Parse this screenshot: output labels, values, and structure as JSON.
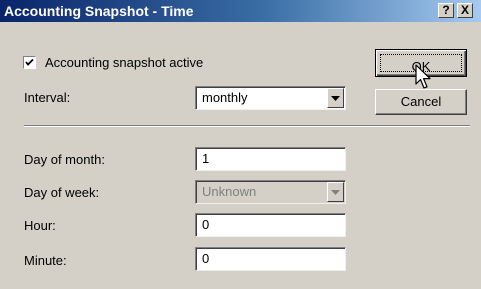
{
  "window": {
    "title": "Accounting Snapshot - Time",
    "help_label": "?",
    "close_label": "X"
  },
  "snapshot": {
    "label": "Accounting snapshot active",
    "checked": true
  },
  "interval": {
    "label": "Interval:",
    "value": "monthly"
  },
  "day_of_month": {
    "label": "Day of month:",
    "value": "1"
  },
  "day_of_week": {
    "label": "Day of week:",
    "value": "Unknown",
    "disabled": true
  },
  "hour": {
    "label": "Hour:",
    "value": "0"
  },
  "minute": {
    "label": "Minute:",
    "value": "0"
  },
  "buttons": {
    "ok": "OK",
    "cancel": "Cancel"
  },
  "colors": {
    "titlebar_start": "#0a246a",
    "titlebar_end": "#a6caf0",
    "dialog_bg": "#d4d0c8"
  }
}
